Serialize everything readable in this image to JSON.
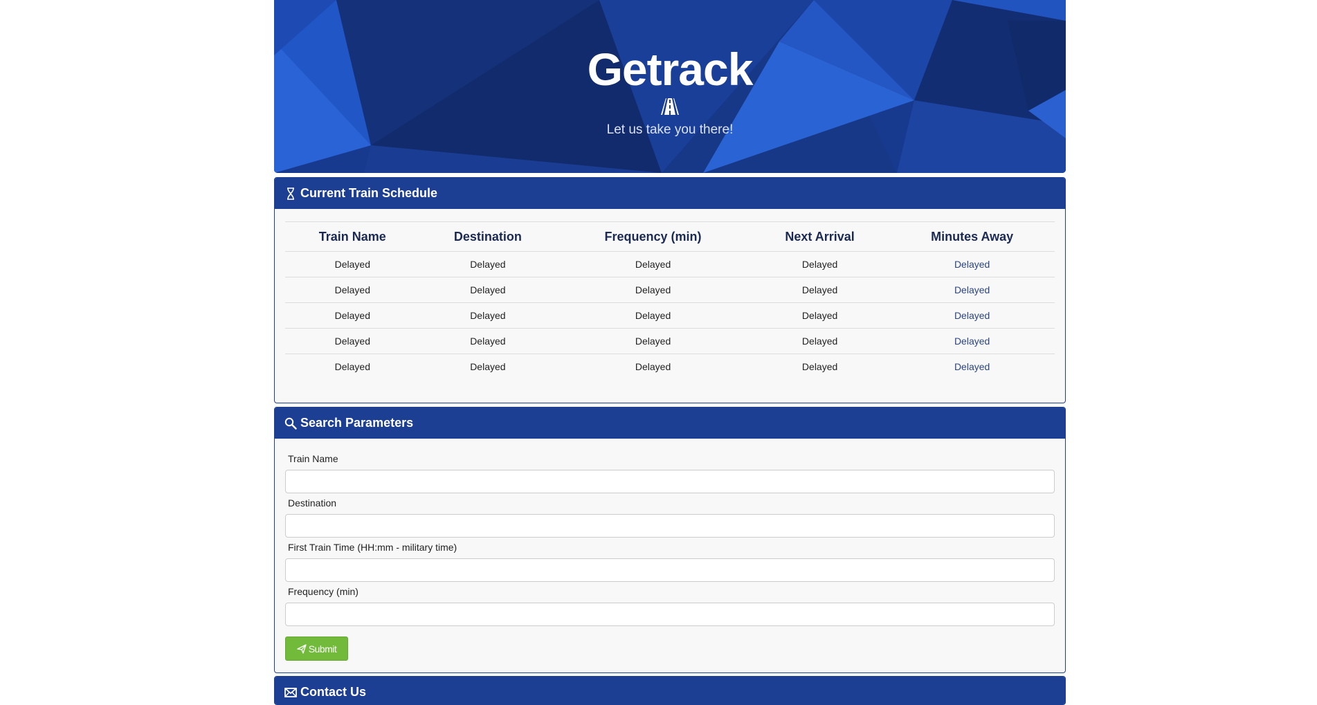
{
  "hero": {
    "title": "Getrack",
    "tagline": "Let us take you there!",
    "icon": "road-icon"
  },
  "schedule": {
    "heading": "Current Train Schedule",
    "icon": "hourglass-icon",
    "columns": [
      "Train Name",
      "Destination",
      "Frequency (min)",
      "Next Arrival",
      "Minutes Away"
    ],
    "rows": [
      [
        "Delayed",
        "Delayed",
        "Delayed",
        "Delayed",
        "Delayed"
      ],
      [
        "Delayed",
        "Delayed",
        "Delayed",
        "Delayed",
        "Delayed"
      ],
      [
        "Delayed",
        "Delayed",
        "Delayed",
        "Delayed",
        "Delayed"
      ],
      [
        "Delayed",
        "Delayed",
        "Delayed",
        "Delayed",
        "Delayed"
      ],
      [
        "Delayed",
        "Delayed",
        "Delayed",
        "Delayed",
        "Delayed"
      ]
    ]
  },
  "search": {
    "heading": "Search Parameters",
    "icon": "search-icon",
    "fields": [
      {
        "label": "Train Name",
        "value": "",
        "placeholder": ""
      },
      {
        "label": "Destination",
        "value": "",
        "placeholder": ""
      },
      {
        "label": "First Train Time (HH:mm - military time)",
        "value": "",
        "placeholder": ""
      },
      {
        "label": "Frequency (min)",
        "value": "",
        "placeholder": ""
      }
    ],
    "submit_label": "Submit",
    "submit_icon": "send-icon"
  },
  "contact": {
    "heading": "Contact Us",
    "icon": "envelope-icon"
  },
  "colors": {
    "brand": "#1c3f94",
    "submit": "#72bb3a"
  }
}
